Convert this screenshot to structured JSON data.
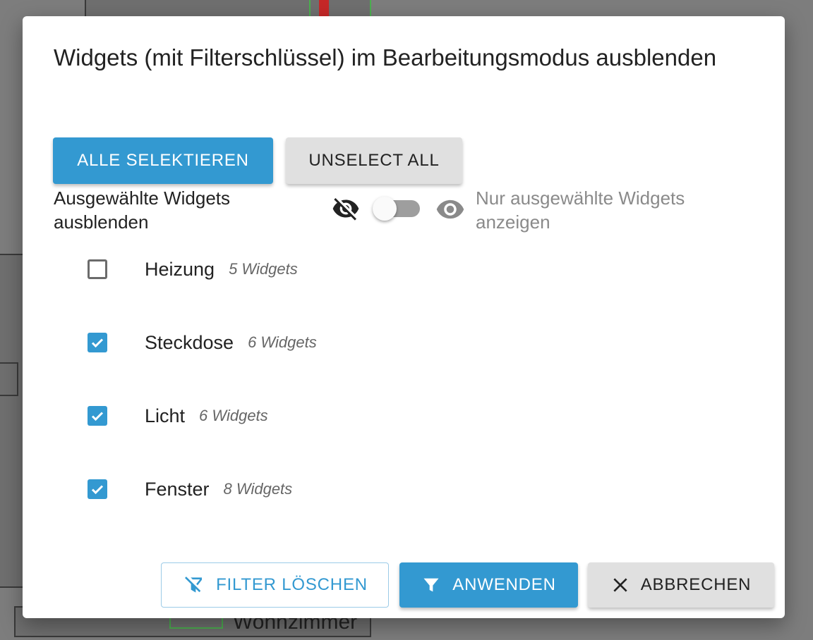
{
  "background": {
    "room_label": "Wohnzimmer"
  },
  "dialog": {
    "title": "Widgets (mit Filterschlüssel) im Bearbeitungsmodus ausblenden",
    "select_all_label": "ALLE SELEKTIEREN",
    "unselect_all_label": "UNSELECT ALL",
    "toggle": {
      "left_label": "Ausgewählte Widgets ausblenden",
      "right_label": "Nur ausgewählte Widgets anzeigen",
      "on": false
    },
    "items": [
      {
        "name": "Heizung",
        "count": "5 Widgets",
        "checked": false
      },
      {
        "name": "Steckdose",
        "count": "6 Widgets",
        "checked": true
      },
      {
        "name": "Licht",
        "count": "6 Widgets",
        "checked": true
      },
      {
        "name": "Fenster",
        "count": "8 Widgets",
        "checked": true
      }
    ],
    "footer": {
      "clear_label": "FILTER LÖSCHEN",
      "apply_label": "ANWENDEN",
      "cancel_label": "ABBRECHEN"
    }
  },
  "colors": {
    "primary": "#3399d1",
    "overlay": "#7d7d7d"
  },
  "icons": [
    "eye-off-icon",
    "eye-icon",
    "checkbox-icon",
    "filter-off-icon",
    "filter-icon",
    "close-icon"
  ]
}
